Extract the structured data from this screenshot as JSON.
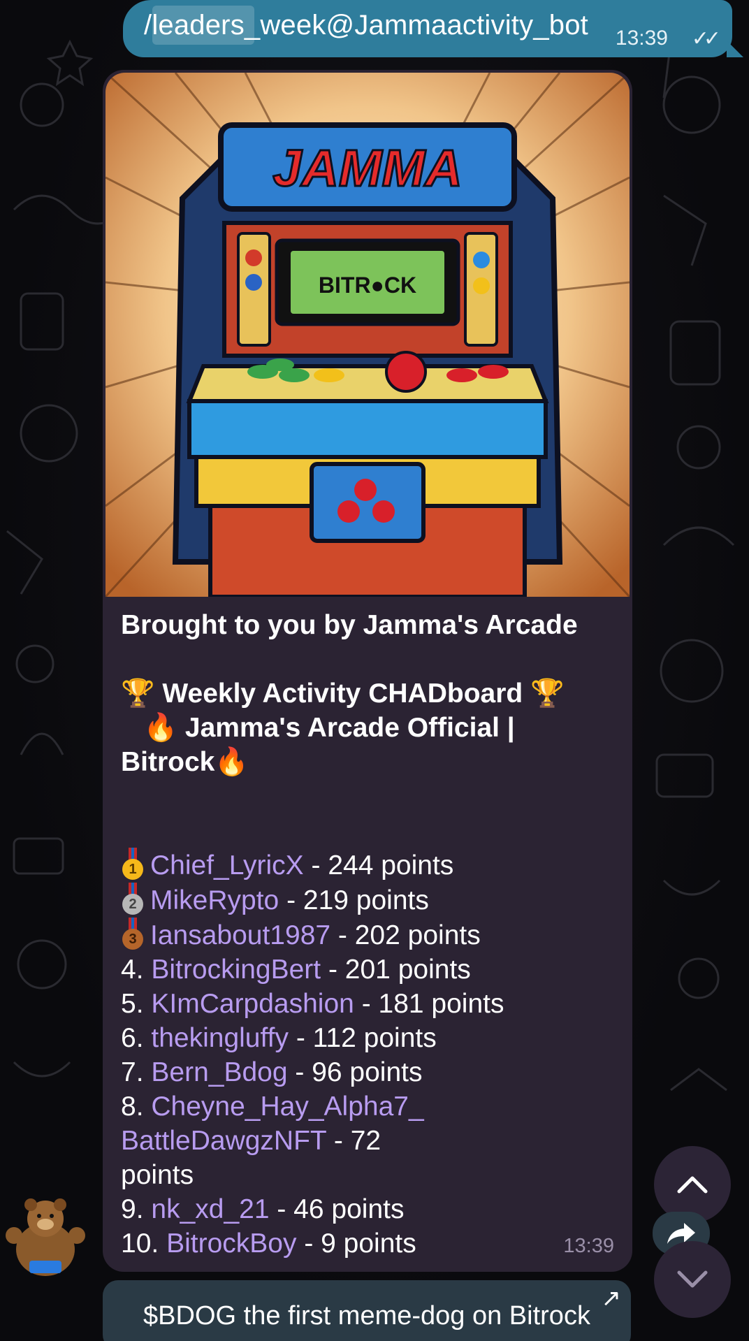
{
  "chat": {
    "command": {
      "text": "/leaders_week@Jammaactivity_bot",
      "time": "13:39",
      "status_icon": "double-check-icon"
    },
    "photo": {
      "marquee": "JAMMA",
      "screen_text": "BITR●CK"
    },
    "message": {
      "intro": "Brought to you by Jamma's Arcade",
      "board_title": "Weekly Activity CHADboard",
      "group_line1": "Jamma's Arcade Official |",
      "group_line2": "Bitrock",
      "entries": [
        {
          "rank": "",
          "medal": "1",
          "user": "Chief_LyricX",
          "score": "- 244 points"
        },
        {
          "rank": "",
          "medal": "2",
          "user": "MikeRypto",
          "score": "- 219 points"
        },
        {
          "rank": "",
          "medal": "3",
          "user": "Iansabout1987",
          "score": "- 202 points"
        },
        {
          "rank": "4.",
          "user": "BitrockingBert",
          "score": "- 201 points"
        },
        {
          "rank": "5.",
          "user": "KImCarpdashion",
          "score": "- 181 points"
        },
        {
          "rank": "6.",
          "user": "thekingluffy",
          "score": "- 112 points"
        },
        {
          "rank": "7.",
          "user": "Bern_Bdog",
          "score": "- 96 points"
        },
        {
          "rank": "8.",
          "user": "Cheyne_Hay_Alpha7_",
          "user_cont": "BattleDawgzNFT",
          "score": "- 72",
          "score_cont": "points"
        },
        {
          "rank": "9.",
          "user": "nk_xd_21",
          "score": "- 46 points"
        },
        {
          "rank": "10.",
          "user": "BitrockBoy",
          "score": "- 9 points"
        }
      ],
      "time": "13:39"
    },
    "url_button": {
      "label": "$BDOG the first meme-dog on Bitrock",
      "icon": "external-arrow-icon"
    }
  },
  "controls": {
    "scroll_up_icon": "chevron-up-icon",
    "scroll_down_icon": "chevron-down-icon",
    "forward_icon": "forward-icon"
  }
}
